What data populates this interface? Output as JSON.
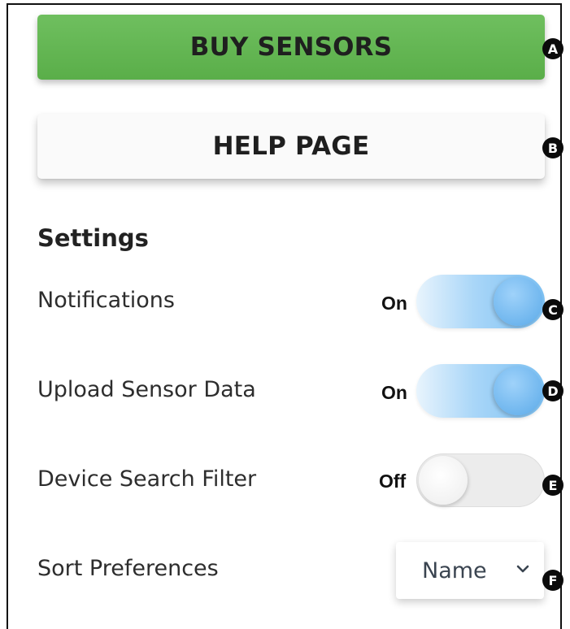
{
  "buttons": {
    "buy_label": "BUY SENSORS",
    "help_label": "HELP PAGE"
  },
  "settings": {
    "title": "Settings",
    "notifications": {
      "label": "Notifications",
      "state": "On",
      "enabled": true
    },
    "upload": {
      "label": "Upload Sensor Data",
      "state": "On",
      "enabled": true
    },
    "device_filter": {
      "label": "Device Search Filter",
      "state": "Off",
      "enabled": false
    },
    "sort": {
      "label": "Sort Preferences",
      "selected": "Name"
    }
  },
  "badges": {
    "a": "A",
    "b": "B",
    "c": "C",
    "d": "D",
    "e": "E",
    "f": "F"
  },
  "icons": {
    "dropdown": "chevron-down-icon"
  },
  "colors": {
    "buy_button": "#5aae49",
    "toggle_on": "#7cc0f2",
    "toggle_off": "#ececec"
  }
}
